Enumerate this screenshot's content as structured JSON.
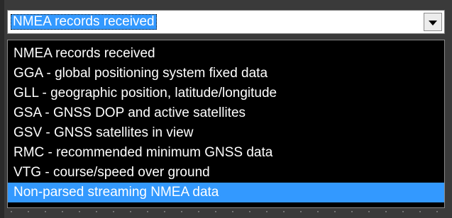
{
  "combo": {
    "value": "NMEA records received"
  },
  "list": {
    "items": [
      "NMEA records received",
      "GGA - global positioning system fixed data",
      "GLL - geographic position, latitude/longitude",
      "GSA - GNSS DOP and active satellites",
      "GSV - GNSS satellites in view",
      "RMC - recommended minimum GNSS data",
      "VTG - course/speed over ground",
      "Non-parsed streaming NMEA data"
    ],
    "selected_index": 7
  },
  "colors": {
    "highlight": "#3399ff",
    "list_background": "#000000",
    "list_text": "#ffffff"
  },
  "icons": {
    "dropdown": "chevron-down-icon"
  }
}
